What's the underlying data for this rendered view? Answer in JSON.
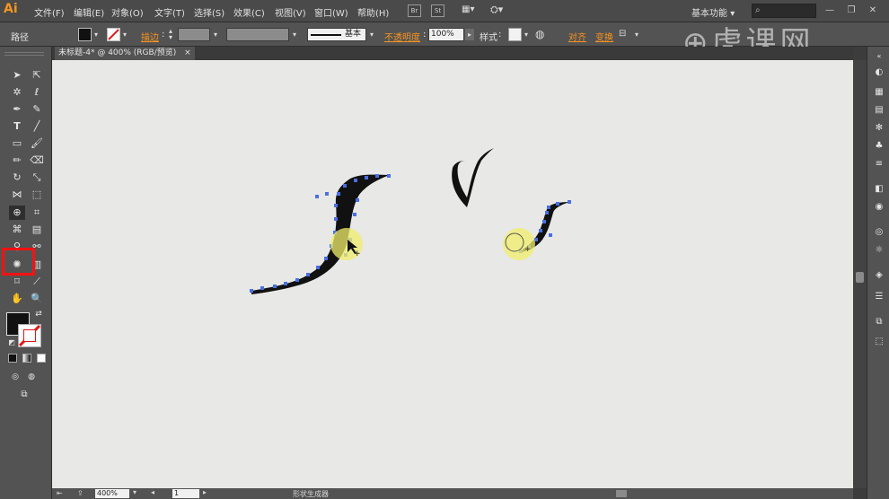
{
  "app": {
    "logo": "Ai",
    "workspace": "基本功能",
    "workspace_arrow": "▾"
  },
  "menu": {
    "items": [
      "文件(F)",
      "编辑(E)",
      "对象(O)",
      "文字(T)",
      "选择(S)",
      "效果(C)",
      "视图(V)",
      "窗口(W)",
      "帮助(H)"
    ],
    "bridge": "Br",
    "stock": "St"
  },
  "control_bar": {
    "object_type": "路径",
    "stroke_label": "描边",
    "stroke_colon": ":",
    "brush_label": "基本",
    "opacity_label": "不透明度",
    "opacity_value": "100%",
    "style_label": "样式",
    "align_label": "对齐",
    "transform_label": "变换"
  },
  "document_tab": {
    "title": "未标题-4* @ 400% (RGB/预览)",
    "close": "×"
  },
  "status_bar": {
    "zoom": "400%",
    "page": "1",
    "tool_name": "形状生成器"
  },
  "watermark": {
    "text": "虎课网",
    "prefix_glyph": "⊕"
  },
  "icons": {
    "selected_tool": "shape-builder-icon"
  },
  "colors": {
    "accent_highlight": "#ff1010",
    "anchor_points": "#4a6fe0",
    "cursor_highlight": "#f0ef6a",
    "fill": "#111111"
  }
}
